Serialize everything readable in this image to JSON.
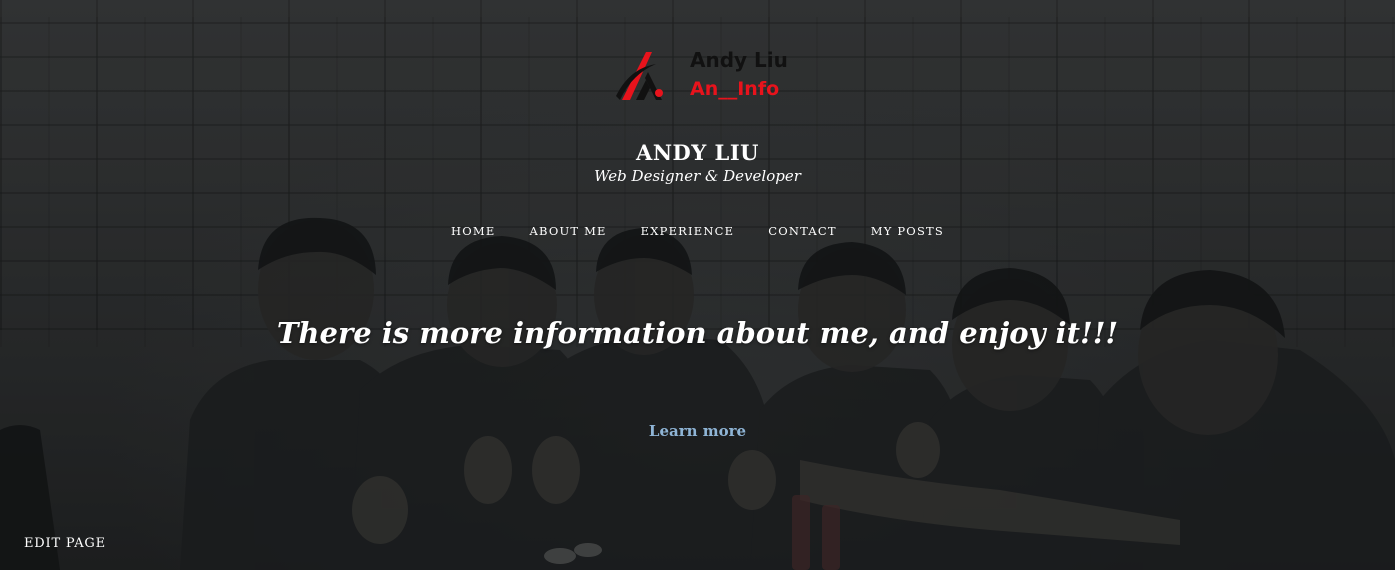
{
  "logo": {
    "name": "Andy Liu",
    "tagline": "An__Info",
    "accent_color": "#e8131c",
    "icon": "logo-mark-icon"
  },
  "site": {
    "title": "ANDY LIU",
    "description": "Web Designer & Developer"
  },
  "nav": {
    "items": [
      {
        "label": "HOME"
      },
      {
        "label": "ABOUT ME"
      },
      {
        "label": "EXPERIENCE"
      },
      {
        "label": "CONTACT"
      },
      {
        "label": "MY POSTS"
      }
    ]
  },
  "hero": {
    "headline": "There is more information about me, and enjoy it!!!",
    "link_label": "Learn more",
    "link_color": "#8fb5d6"
  },
  "footer": {
    "edit_label": "EDIT PAGE"
  }
}
